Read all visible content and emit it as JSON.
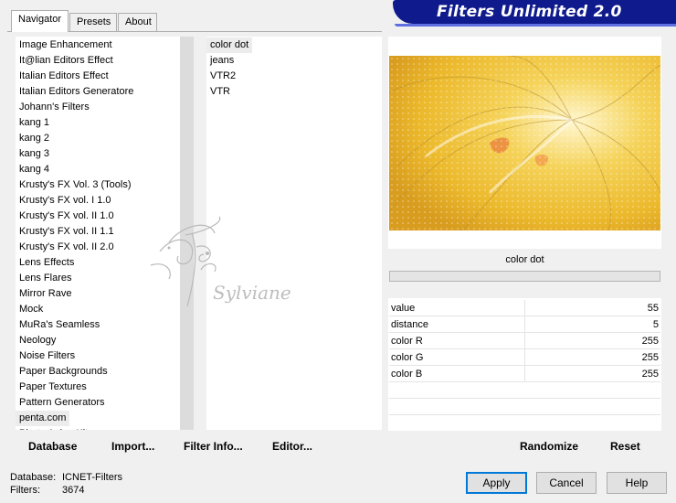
{
  "tabs": [
    "Navigator",
    "Presets",
    "About"
  ],
  "title": "Filters Unlimited 2.0",
  "categories": [
    "Image Enhancement",
    "It@lian Editors Effect",
    "Italian Editors Effect",
    "Italian Editors Generatore",
    "Johann's Filters",
    "kang 1",
    "kang 2",
    "kang 3",
    "kang 4",
    "Krusty's FX Vol. 3 (Tools)",
    "Krusty's FX vol. I 1.0",
    "Krusty's FX vol. II 1.0",
    "Krusty's FX vol. II 1.1",
    "Krusty's FX vol. II 2.0",
    "Lens Effects",
    "Lens Flares",
    "Mirror Rave",
    "Mock",
    "MuRa's Seamless",
    "Neology",
    "Noise Filters",
    "Paper Backgrounds",
    "Paper Textures",
    "Pattern Generators",
    "penta.com",
    "Photo Aging Kit"
  ],
  "selected_category": "penta.com",
  "filters": [
    "color dot",
    "jeans",
    "VTR2",
    "VTR"
  ],
  "selected_filter": "color dot",
  "watermark": "Sylviane",
  "filter_name": "color dot",
  "params": [
    {
      "label": "value",
      "value": "55"
    },
    {
      "label": "distance",
      "value": "5"
    },
    {
      "label": "color R",
      "value": "255"
    },
    {
      "label": "color G",
      "value": "255"
    },
    {
      "label": "color B",
      "value": "255"
    }
  ],
  "buttons": {
    "database": "Database",
    "import": "Import...",
    "filter_info": "Filter Info...",
    "editor": "Editor...",
    "randomize": "Randomize",
    "reset": "Reset",
    "apply": "Apply",
    "cancel": "Cancel",
    "help": "Help"
  },
  "status": {
    "database_label": "Database:",
    "database_value": "ICNET-Filters",
    "filters_label": "Filters:",
    "filters_value": "3674"
  },
  "colors": {
    "banner": "#0f1a8c",
    "banner_stripe": "#5f6ee0",
    "preview_base": "#f2c23a"
  },
  "icons": {
    "watermark": "calligraphic-flourish-logo"
  }
}
